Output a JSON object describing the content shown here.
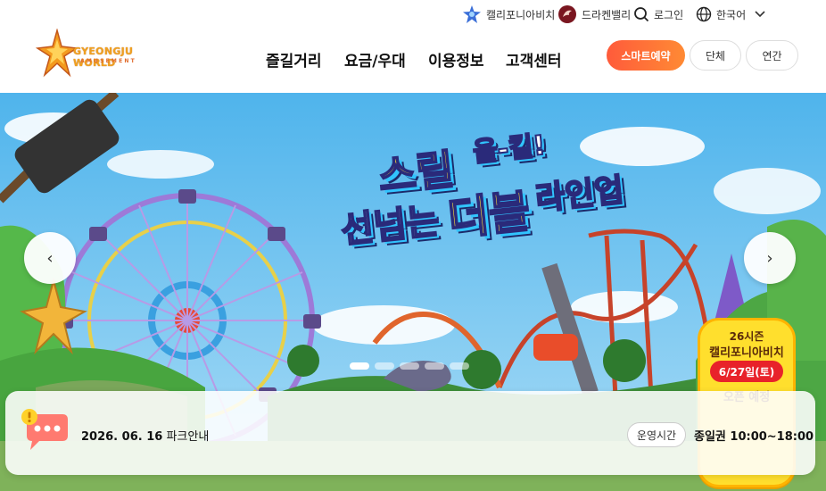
{
  "utility": {
    "california_beach": "캘리포니아비치",
    "dragon_valley": "드라켄밸리",
    "login": "로그인",
    "language": "한국어"
  },
  "header": {
    "logo_text": "GYEONGJU WORLD",
    "logo_sub": "AMUSEMENT",
    "nav": [
      "즐길거리",
      "요금/우대",
      "이용정보",
      "고객센터"
    ],
    "smart_reservation": "스마트예약",
    "group": "단체",
    "annual": "연간"
  },
  "hero": {
    "headline_1a": "스릴",
    "headline_1b": "올-킬!",
    "headline_2a": "선넘는",
    "headline_2b": "더블",
    "headline_2c": "라인업",
    "prev_arrow": "‹",
    "next_arrow": "›",
    "badge": {
      "line1": "26시즌",
      "line2": "캘리포니아비치",
      "date": "6/27일(토)",
      "line3": "오픈 예정"
    },
    "slides": 5,
    "active_slide": 1
  },
  "notice": {
    "date": "2026. 06. 16",
    "label": "파크안내",
    "hours_badge": "운영시간",
    "hours": "종일권 10:00~18:00"
  },
  "colors": {
    "accent": "#ff6a3a",
    "headline_yellow": "#ffe23a",
    "sky": "#7cc8f2"
  },
  "icons": {
    "california_beach": "star-logo-icon",
    "dragon_valley": "dragon-logo-icon",
    "login": "search-icon",
    "language": "globe-icon",
    "dropdown": "chevron-down-icon",
    "notice": "chat-alert-icon"
  }
}
